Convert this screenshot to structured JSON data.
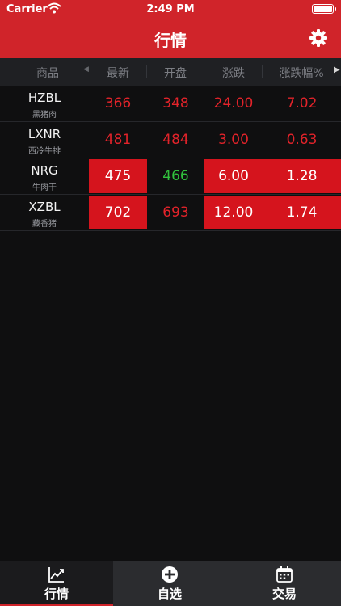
{
  "status_bar": {
    "carrier": "Carrier",
    "time": "2:49 PM"
  },
  "nav": {
    "title": "行情",
    "settings_icon": "gear-icon"
  },
  "table": {
    "columns": [
      "商品",
      "最新",
      "开盘",
      "涨跌",
      "涨跌幅%"
    ],
    "rows": [
      {
        "symbol": "HZBL",
        "name": "黑猪肉",
        "latest": "366",
        "open": "348",
        "change": "24.00",
        "change_pct": "7.02"
      },
      {
        "symbol": "LXNR",
        "name": "西冷牛排",
        "latest": "481",
        "open": "484",
        "change": "3.00",
        "change_pct": "0.63"
      },
      {
        "symbol": "NRG",
        "name": "牛肉干",
        "latest": "475",
        "open": "466",
        "change": "6.00",
        "change_pct": "1.28"
      },
      {
        "symbol": "XZBL",
        "name": "藏香猪",
        "latest": "702",
        "open": "693",
        "change": "12.00",
        "change_pct": "1.74"
      }
    ]
  },
  "colors": {
    "brand": "#d0242a",
    "up": "#e2232a",
    "down": "#31c23d",
    "highlight": "#d5141d",
    "background": "#0f0f10"
  },
  "tabs": [
    {
      "label": "行情",
      "icon": "chart-line-icon",
      "active": true
    },
    {
      "label": "自选",
      "icon": "plus-circle-icon",
      "active": false
    },
    {
      "label": "交易",
      "icon": "calendar-icon",
      "active": false
    }
  ]
}
